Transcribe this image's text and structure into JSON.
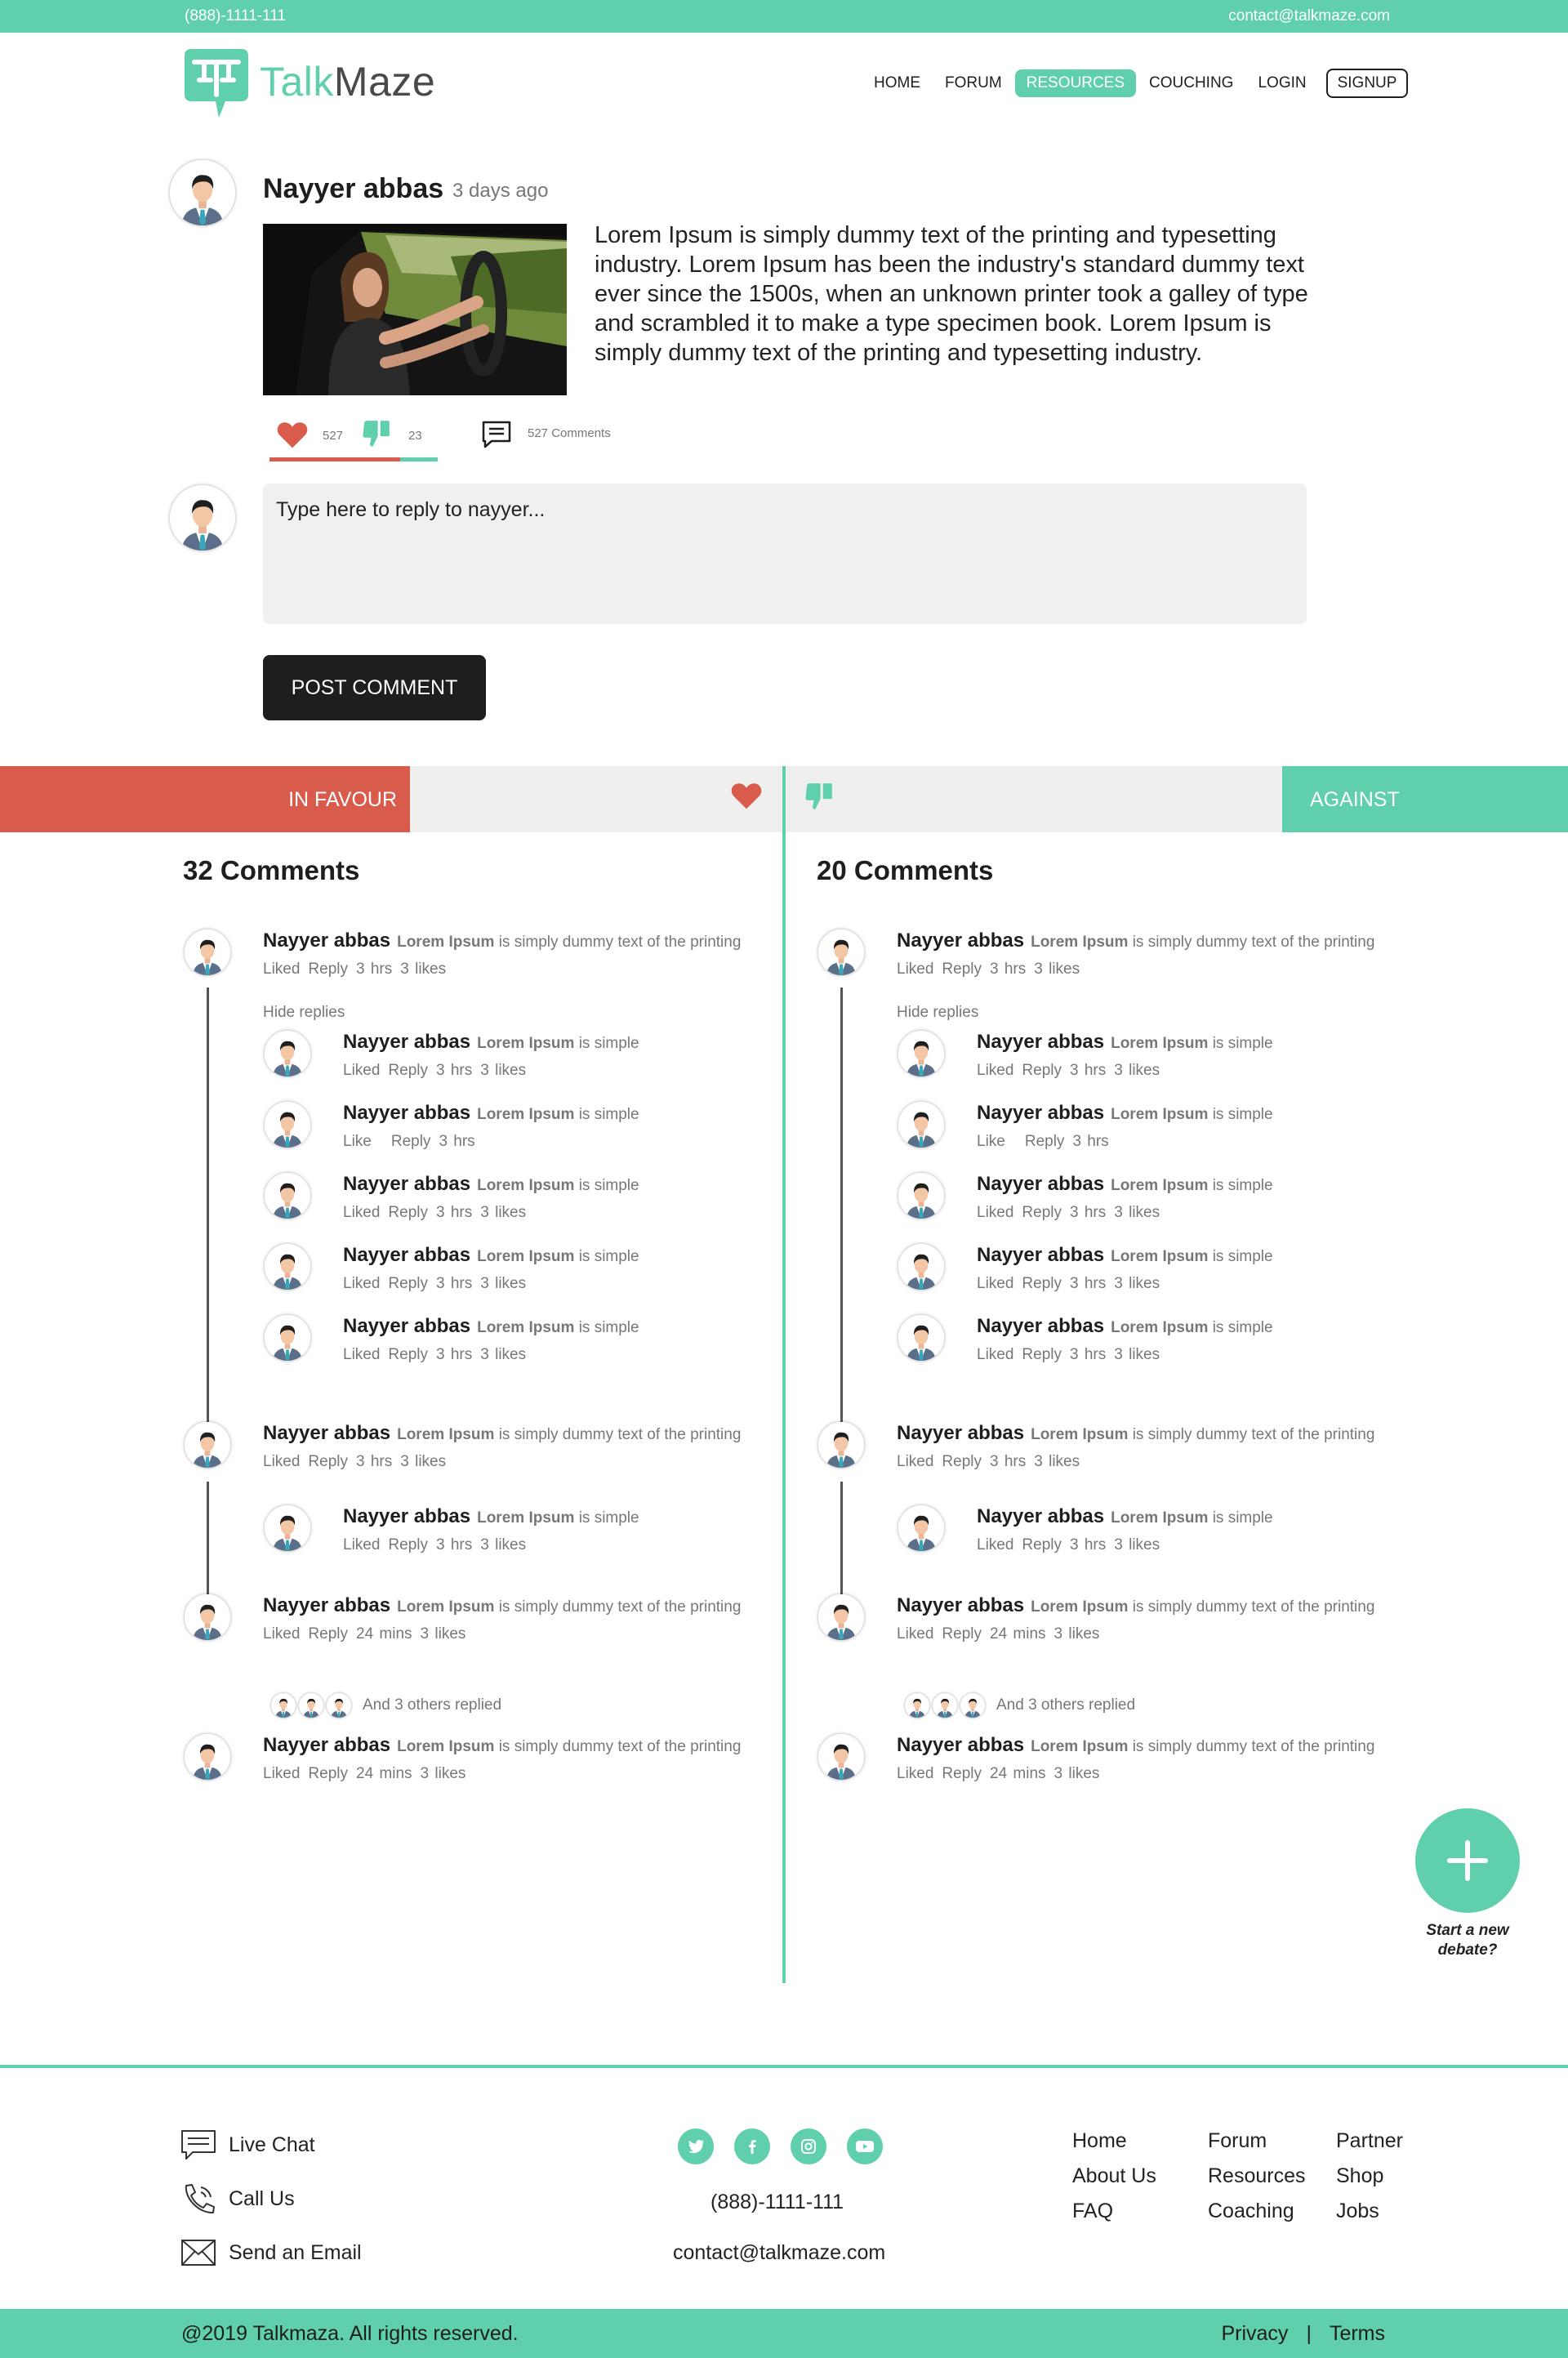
{
  "topbar": {
    "phone": "(888)-1111-111",
    "email": "contact@talkmaze.com"
  },
  "brand": {
    "name_part1": "Talk",
    "name_part2": "Maze",
    "accent": "#5fcfad",
    "red": "#d95b4b",
    "dark": "#1e1e1e"
  },
  "nav": {
    "home": "HOME",
    "forum": "FORUM",
    "resources": "RESOURCES",
    "coaching": "COUCHING",
    "login": "LOGIN",
    "signup": "SIGNUP"
  },
  "post": {
    "author": "Nayyer abbas",
    "time": "3 days ago",
    "body": "Lorem Ipsum is simply dummy text of the printing and typesetting industry. Lorem Ipsum has been the industry's standard dummy text ever since the 1500s, when an unknown printer took a galley of type and scrambled it to make a type specimen book. Lorem Ipsum is simply dummy text of the printing and typesetting industry.",
    "likes": "527",
    "dislikes": "23",
    "comments": "527 Comments",
    "reply_placeholder": "Type here to reply to nayyer...",
    "post_button": "POST COMMENT"
  },
  "debate": {
    "favour_label": "IN FAVOUR",
    "against_label": "AGAINST",
    "favour": {
      "title": "32 Comments",
      "hide_replies": "Hide replies",
      "others": "And 3 others replied"
    },
    "against": {
      "title": "20 Comments",
      "hide_replies": "Hide replies",
      "others": "And 3 others replied"
    }
  },
  "comment": {
    "name": "Nayyer abbas",
    "bold": "Lorem Ipsum",
    "long_text": "is simply dummy text of the printing",
    "short_text": "is simple",
    "liked": "Liked",
    "like": "Like",
    "reply": "Reply",
    "hrs": "3 hrs",
    "mins": "24 mins",
    "likes": "3 likes"
  },
  "fab": {
    "label_line1": "Start a new",
    "label_line2": "debate?"
  },
  "footer": {
    "live_chat": "Live Chat",
    "call_us": "Call Us",
    "send_email": "Send an Email",
    "phone": "(888)-1111-111",
    "email": "contact@talkmaze.com",
    "col1": [
      "Home",
      "About Us",
      "FAQ"
    ],
    "col2": [
      "Forum",
      "Resources",
      "Coaching"
    ],
    "col3": [
      "Partner",
      "Shop",
      "Jobs"
    ],
    "copyright": "@2019 Talkmaza. All rights reserved.",
    "privacy": "Privacy",
    "sep": "|",
    "terms": "Terms"
  }
}
